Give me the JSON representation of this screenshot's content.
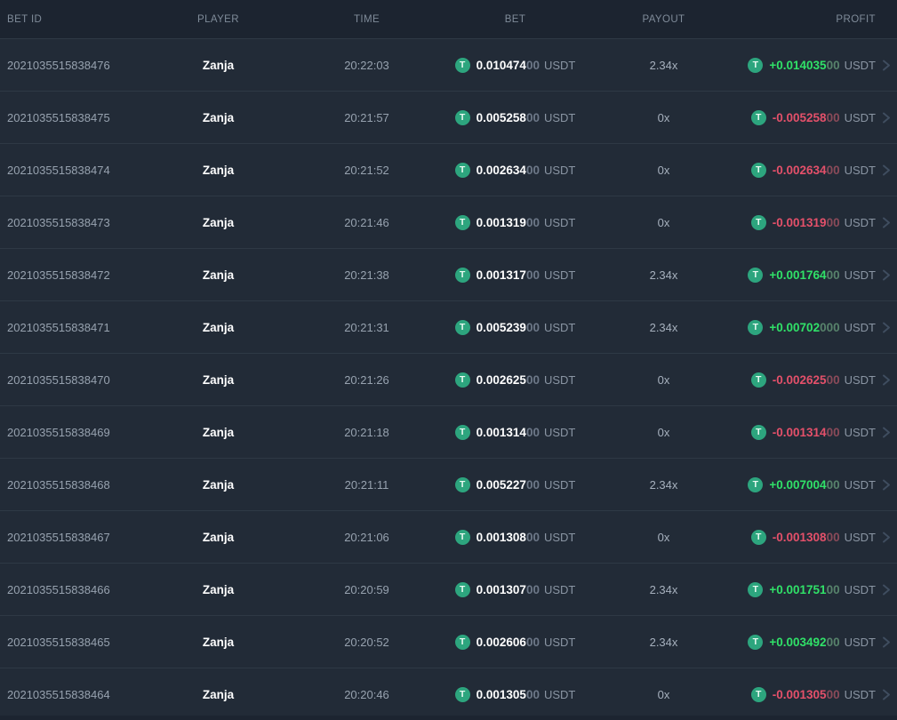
{
  "table": {
    "columns": [
      {
        "label": "BET ID"
      },
      {
        "label": "PLAYER"
      },
      {
        "label": "TIME"
      },
      {
        "label": "BET"
      },
      {
        "label": "PAYOUT"
      },
      {
        "label": "PROFIT"
      }
    ],
    "currency": "USDT",
    "currency_icon": "tether-icon",
    "row_chevron_icon": "chevron-right-icon",
    "rows": [
      {
        "bet_id": "2021035515838476",
        "player": "Zanja",
        "time": "20:22:03",
        "bet": {
          "main": "0.010474",
          "zeros": "00"
        },
        "payout": "2.34x",
        "profit": {
          "main": "+0.014035",
          "zeros": "00",
          "direction": "win"
        }
      },
      {
        "bet_id": "2021035515838475",
        "player": "Zanja",
        "time": "20:21:57",
        "bet": {
          "main": "0.005258",
          "zeros": "00"
        },
        "payout": "0x",
        "profit": {
          "main": "-0.005258",
          "zeros": "00",
          "direction": "loss"
        }
      },
      {
        "bet_id": "2021035515838474",
        "player": "Zanja",
        "time": "20:21:52",
        "bet": {
          "main": "0.002634",
          "zeros": "00"
        },
        "payout": "0x",
        "profit": {
          "main": "-0.002634",
          "zeros": "00",
          "direction": "loss"
        }
      },
      {
        "bet_id": "2021035515838473",
        "player": "Zanja",
        "time": "20:21:46",
        "bet": {
          "main": "0.001319",
          "zeros": "00"
        },
        "payout": "0x",
        "profit": {
          "main": "-0.001319",
          "zeros": "00",
          "direction": "loss"
        }
      },
      {
        "bet_id": "2021035515838472",
        "player": "Zanja",
        "time": "20:21:38",
        "bet": {
          "main": "0.001317",
          "zeros": "00"
        },
        "payout": "2.34x",
        "profit": {
          "main": "+0.001764",
          "zeros": "00",
          "direction": "win"
        }
      },
      {
        "bet_id": "2021035515838471",
        "player": "Zanja",
        "time": "20:21:31",
        "bet": {
          "main": "0.005239",
          "zeros": "00"
        },
        "payout": "2.34x",
        "profit": {
          "main": "+0.00702",
          "zeros": "000",
          "direction": "win"
        }
      },
      {
        "bet_id": "2021035515838470",
        "player": "Zanja",
        "time": "20:21:26",
        "bet": {
          "main": "0.002625",
          "zeros": "00"
        },
        "payout": "0x",
        "profit": {
          "main": "-0.002625",
          "zeros": "00",
          "direction": "loss"
        }
      },
      {
        "bet_id": "2021035515838469",
        "player": "Zanja",
        "time": "20:21:18",
        "bet": {
          "main": "0.001314",
          "zeros": "00"
        },
        "payout": "0x",
        "profit": {
          "main": "-0.001314",
          "zeros": "00",
          "direction": "loss"
        }
      },
      {
        "bet_id": "2021035515838468",
        "player": "Zanja",
        "time": "20:21:11",
        "bet": {
          "main": "0.005227",
          "zeros": "00"
        },
        "payout": "2.34x",
        "profit": {
          "main": "+0.007004",
          "zeros": "00",
          "direction": "win"
        }
      },
      {
        "bet_id": "2021035515838467",
        "player": "Zanja",
        "time": "20:21:06",
        "bet": {
          "main": "0.001308",
          "zeros": "00"
        },
        "payout": "0x",
        "profit": {
          "main": "-0.001308",
          "zeros": "00",
          "direction": "loss"
        }
      },
      {
        "bet_id": "2021035515838466",
        "player": "Zanja",
        "time": "20:20:59",
        "bet": {
          "main": "0.001307",
          "zeros": "00"
        },
        "payout": "2.34x",
        "profit": {
          "main": "+0.001751",
          "zeros": "00",
          "direction": "win"
        }
      },
      {
        "bet_id": "2021035515838465",
        "player": "Zanja",
        "time": "20:20:52",
        "bet": {
          "main": "0.002606",
          "zeros": "00"
        },
        "payout": "2.34x",
        "profit": {
          "main": "+0.003492",
          "zeros": "00",
          "direction": "win"
        }
      },
      {
        "bet_id": "2021035515838464",
        "player": "Zanja",
        "time": "20:20:46",
        "bet": {
          "main": "0.001305",
          "zeros": "00"
        },
        "payout": "0x",
        "profit": {
          "main": "-0.001305",
          "zeros": "00",
          "direction": "loss"
        }
      }
    ]
  },
  "icons": {
    "tether_glyph": "T"
  },
  "colors": {
    "header_bg": "#1c2430",
    "row_bg": "#222b37",
    "separator": "#2e3945",
    "profit_win": "#30e168",
    "profit_loss": "#e4506a",
    "tether_green": "#2da57e"
  }
}
